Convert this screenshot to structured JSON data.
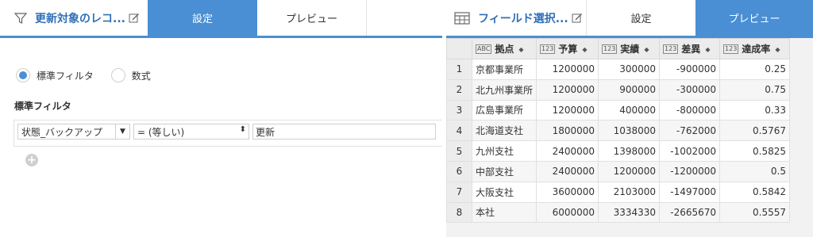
{
  "left_panel": {
    "title": "更新対象のレコ...",
    "tabs": [
      {
        "label": "設定",
        "active": true
      },
      {
        "label": "プレビュー",
        "active": false
      }
    ],
    "filter_mode": {
      "options": [
        {
          "label": "標準フィルタ",
          "checked": true
        },
        {
          "label": "数式",
          "checked": false
        }
      ]
    },
    "section_title": "標準フィルタ",
    "filter": {
      "field": "状態_バックアップ",
      "operator": "= (等しい)",
      "value": "更新"
    },
    "add_icon": "plus-circle-icon"
  },
  "right_panel": {
    "title": "フィールド選択...",
    "tabs": [
      {
        "label": "設定",
        "active": false
      },
      {
        "label": "プレビュー",
        "active": true
      }
    ],
    "columns": [
      {
        "type": "ABC",
        "name": "拠点"
      },
      {
        "type": "123",
        "name": "予算"
      },
      {
        "type": "123",
        "name": "実績"
      },
      {
        "type": "123",
        "name": "差異"
      },
      {
        "type": "123",
        "name": "達成率"
      }
    ],
    "rows": [
      {
        "num": "1",
        "cells": [
          "京都事業所",
          "1200000",
          "300000",
          "-900000",
          "0.25"
        ]
      },
      {
        "num": "2",
        "cells": [
          "北九州事業所",
          "1200000",
          "900000",
          "-300000",
          "0.75"
        ]
      },
      {
        "num": "3",
        "cells": [
          "広島事業所",
          "1200000",
          "400000",
          "-800000",
          "0.33"
        ]
      },
      {
        "num": "4",
        "cells": [
          "北海道支社",
          "1800000",
          "1038000",
          "-762000",
          "0.5767"
        ]
      },
      {
        "num": "5",
        "cells": [
          "九州支社",
          "2400000",
          "1398000",
          "-1002000",
          "0.5825"
        ]
      },
      {
        "num": "6",
        "cells": [
          "中部支社",
          "2400000",
          "1200000",
          "-1200000",
          "0.5"
        ]
      },
      {
        "num": "7",
        "cells": [
          "大阪支社",
          "3600000",
          "2103000",
          "-1497000",
          "0.5842"
        ]
      },
      {
        "num": "8",
        "cells": [
          "本社",
          "6000000",
          "3334330",
          "-2665670",
          "0.5557"
        ]
      }
    ]
  },
  "colors": {
    "accent": "#4a8fd3",
    "title_text": "#2f6fb8"
  }
}
